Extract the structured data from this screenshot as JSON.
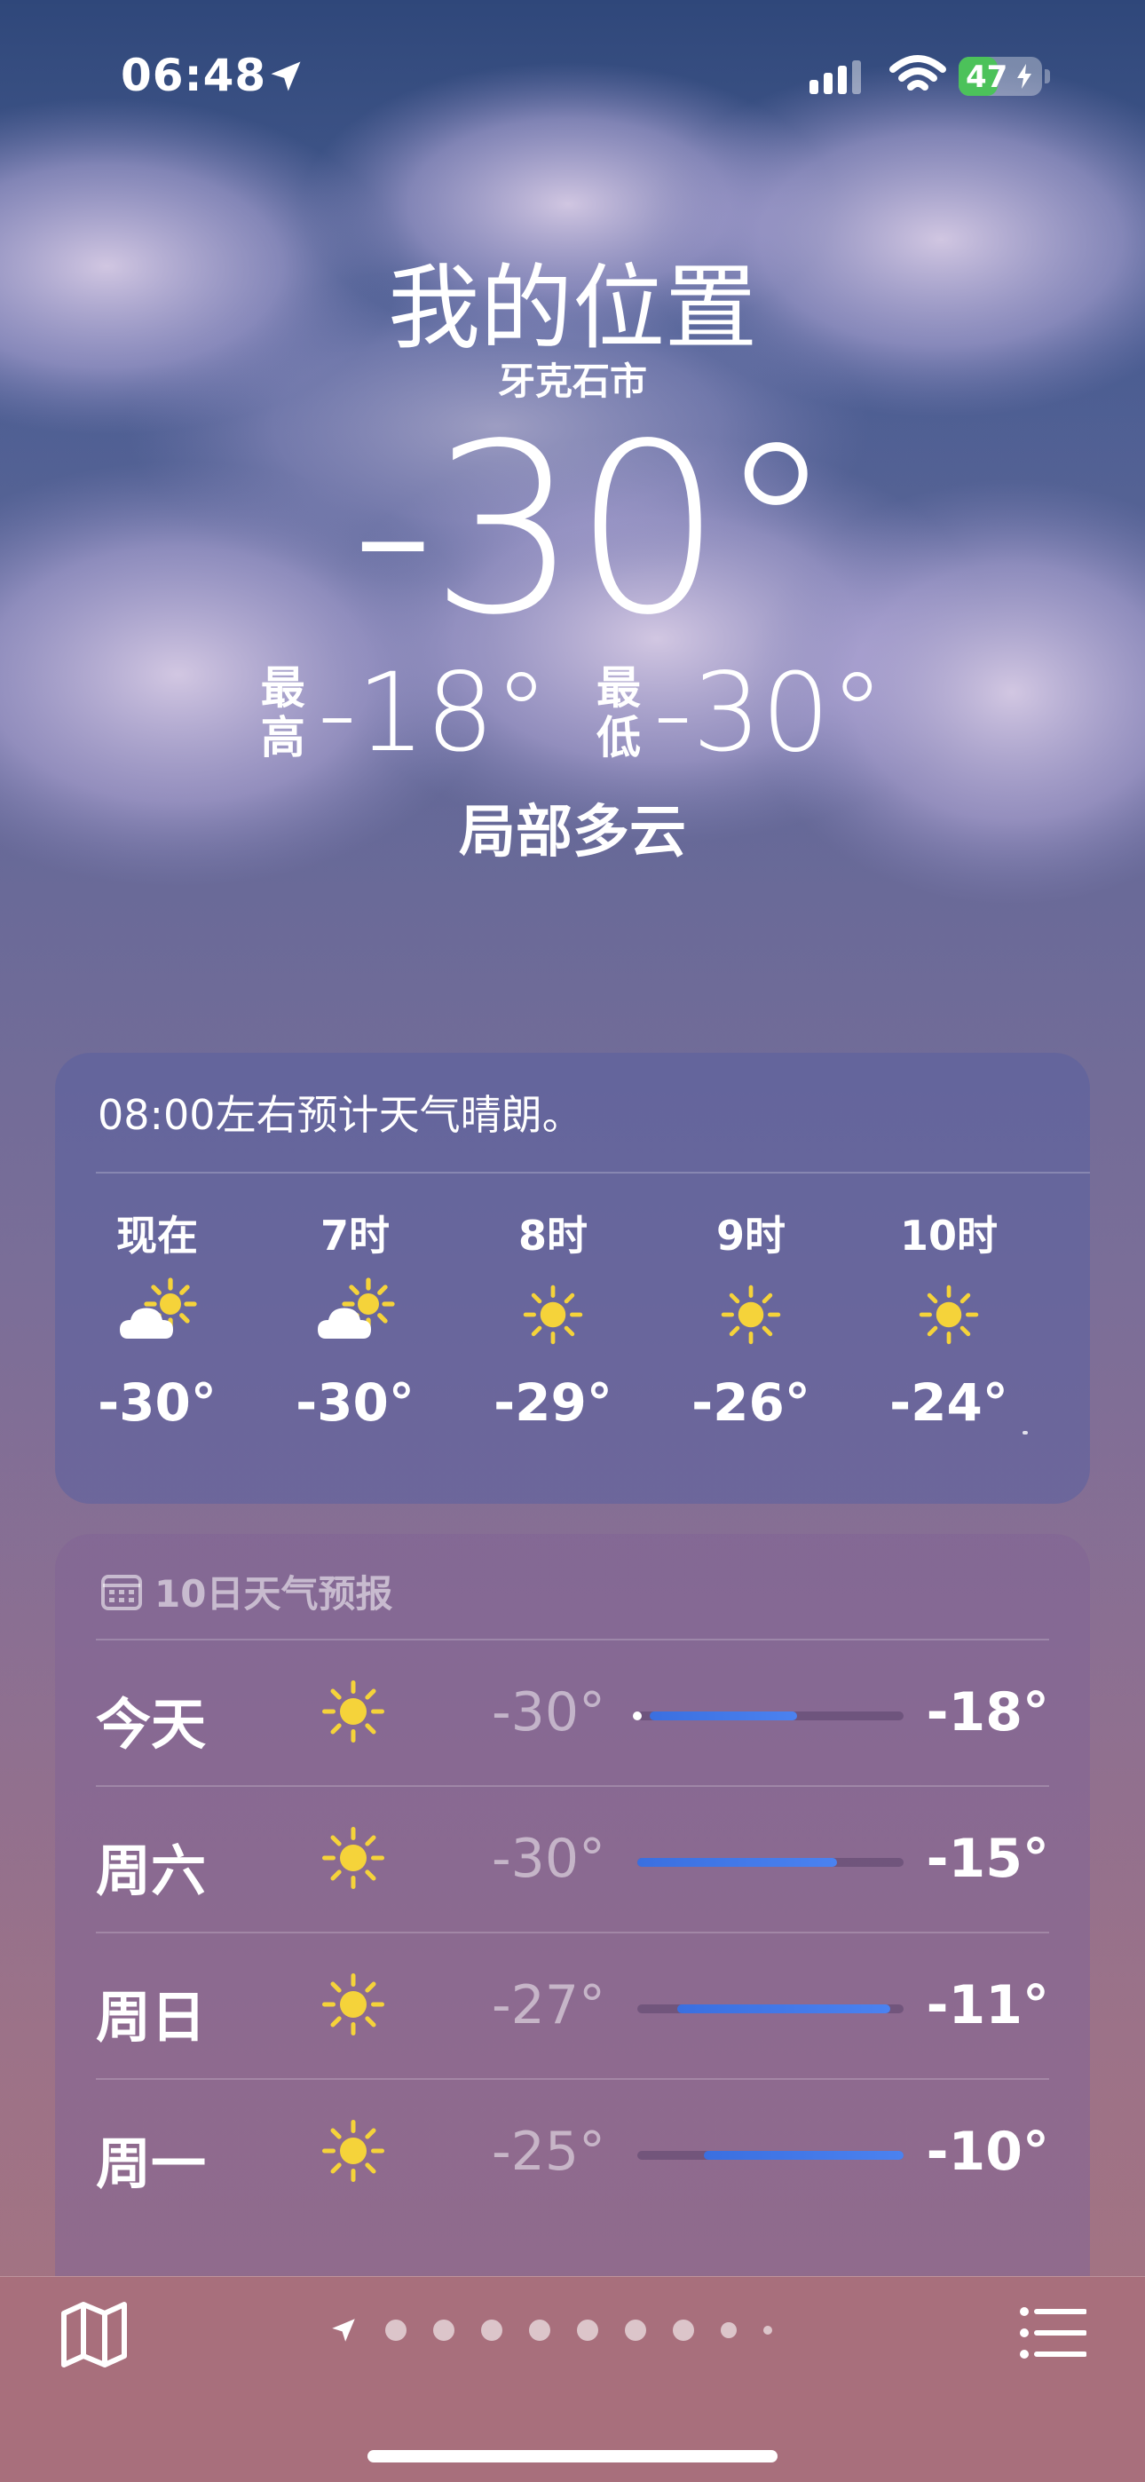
{
  "status_bar": {
    "time": "06:48",
    "battery": "47",
    "battery_level_percent": 47,
    "icons": [
      "location-arrow-icon",
      "cellular-signal-icon",
      "wifi-icon",
      "battery-charging-icon"
    ]
  },
  "hero": {
    "title": "我的位置",
    "city": "牙克石市",
    "current_temp": "-30°",
    "high_label": [
      "最",
      "高"
    ],
    "high_value": "-18°",
    "low_label": [
      "最",
      "低"
    ],
    "low_value": "-30°",
    "condition": "局部多云"
  },
  "hourly": {
    "summary": "08:00左右预计天气晴朗。",
    "items": [
      {
        "label": "现在",
        "icon": "partly-cloudy-icon",
        "temp": "-30°"
      },
      {
        "label": "7时",
        "icon": "partly-cloudy-icon",
        "temp": "-30°"
      },
      {
        "label": "8时",
        "icon": "sun-icon",
        "temp": "-29°"
      },
      {
        "label": "9时",
        "icon": "sun-icon",
        "temp": "-26°"
      },
      {
        "label": "10时",
        "icon": "sun-icon",
        "temp": "-24°"
      }
    ]
  },
  "daily": {
    "header": "10日天气预报",
    "header_icon": "calendar-icon",
    "range_min": -30,
    "range_max": -10,
    "items": [
      {
        "day": "今天",
        "icon": "sun-icon",
        "low": "-30°",
        "high": "-18°",
        "low_val": -30,
        "high_val": -18,
        "current": -30
      },
      {
        "day": "周六",
        "icon": "sun-icon",
        "low": "-30°",
        "high": "-15°",
        "low_val": -30,
        "high_val": -15
      },
      {
        "day": "周日",
        "icon": "sun-icon",
        "low": "-27°",
        "high": "-11°",
        "low_val": -27,
        "high_val": -11
      },
      {
        "day": "周一",
        "icon": "sun-icon",
        "low": "-25°",
        "high": "-10°",
        "low_val": -25,
        "high_val": -10
      }
    ]
  },
  "toolbar": {
    "map_icon": "map-icon",
    "list_icon": "list-icon",
    "page_count": 9,
    "current_page_icon": "location-arrow-icon"
  },
  "colors": {
    "bar": "#3a6fe0",
    "sun": "#f5d33a",
    "battery": "#4cc25a"
  }
}
